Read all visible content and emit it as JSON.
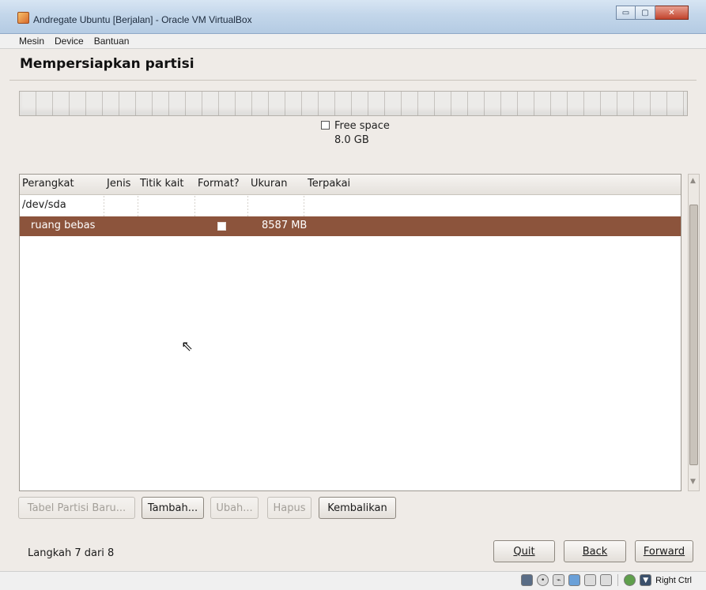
{
  "window": {
    "title": "Andregate Ubuntu [Berjalan] - Oracle VM VirtualBox",
    "minimize_glyph": "▭",
    "maximize_glyph": "▢",
    "close_glyph": "✕"
  },
  "vbox_menu": [
    "Mesin",
    "Device",
    "Bantuan"
  ],
  "installer": {
    "heading": "Mempersiapkan partisi",
    "disk_legend": {
      "label": "Free space",
      "size": "8.0 GB"
    },
    "table": {
      "columns": [
        "Perangkat",
        "Jenis",
        "Titik kait",
        "Format?",
        "Ukuran",
        "Terpakai"
      ],
      "rows": [
        {
          "device": "/dev/sda",
          "type": "",
          "mount": "",
          "format": false,
          "size": "",
          "used": "",
          "selected": false
        },
        {
          "device": "ruang bebas",
          "type": "",
          "mount": "",
          "format": false,
          "size": "8587 MB",
          "used": "",
          "selected": true
        }
      ]
    },
    "partition_buttons": {
      "new_table": "Tabel Partisi Baru...",
      "add": "Tambah...",
      "change": "Ubah...",
      "delete": "Hapus",
      "revert": "Kembalikan"
    },
    "step": "Langkah 7 dari 8",
    "nav": {
      "quit": "Quit",
      "back": "Back",
      "forward": "Forward"
    }
  },
  "statusbar": {
    "host_key": "Right Ctrl"
  },
  "colors": {
    "selection": "#8c543c",
    "titlebar": "#c3d6ea",
    "background": "#efebe7"
  }
}
